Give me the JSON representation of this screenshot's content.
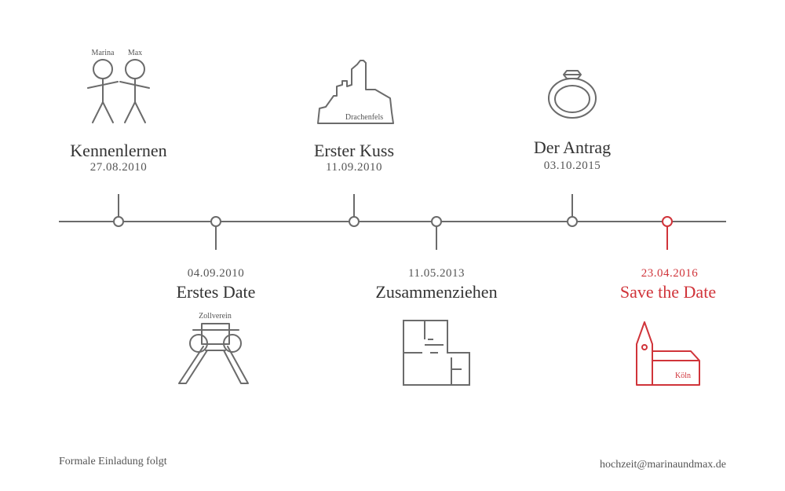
{
  "accent_color": "#d0343a",
  "line_color": "#6b6b6b",
  "events": [
    {
      "title": "Kennenlernen",
      "date": "27.08.2010",
      "icon": "stick-figures-icon",
      "caption_left": "Marina",
      "caption_right": "Max"
    },
    {
      "title": "Erstes Date",
      "date": "04.09.2010",
      "icon": "mine-tower-icon",
      "caption": "Zollverein"
    },
    {
      "title": "Erster Kuss",
      "date": "11.09.2010",
      "icon": "castle-ruin-icon",
      "caption": "Drachenfels"
    },
    {
      "title": "Zusammenziehen",
      "date": "11.05.2013",
      "icon": "floor-plan-icon"
    },
    {
      "title": "Der Antrag",
      "date": "03.10.2015",
      "icon": "ring-icon"
    },
    {
      "title": "Save the Date",
      "date": "23.04.2016",
      "icon": "church-icon",
      "caption": "Köln"
    }
  ],
  "footer": {
    "left": "Formale Einladung folgt",
    "right": "hochzeit@marinaundmax.de"
  }
}
